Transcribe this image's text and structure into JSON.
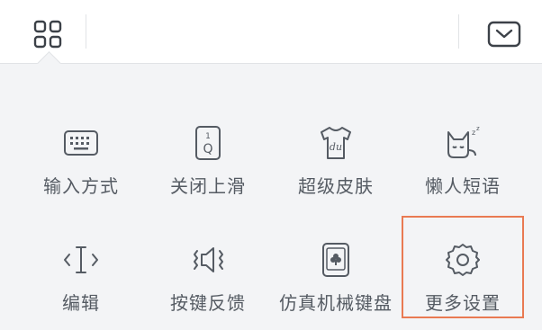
{
  "toolbar": {
    "left_icon": "grid-icon",
    "right_icon": "collapse-keyboard-icon"
  },
  "menu": {
    "items": [
      {
        "label": "输入方式",
        "icon": "keyboard-icon"
      },
      {
        "label": "关闭上滑",
        "icon": "swipe-up-key-icon"
      },
      {
        "label": "超级皮肤",
        "icon": "tshirt-skin-icon"
      },
      {
        "label": "懒人短语",
        "icon": "sleeping-cat-icon"
      },
      {
        "label": "编辑",
        "icon": "text-cursor-icon"
      },
      {
        "label": "按键反馈",
        "icon": "speaker-vibration-icon"
      },
      {
        "label": "仿真机械键盘",
        "icon": "mechanical-keycap-icon"
      },
      {
        "label": "更多设置",
        "icon": "gear-icon"
      }
    ]
  },
  "colors": {
    "highlight": "#e97a52",
    "icon": "#555b63",
    "background": "#f3f4f6"
  }
}
